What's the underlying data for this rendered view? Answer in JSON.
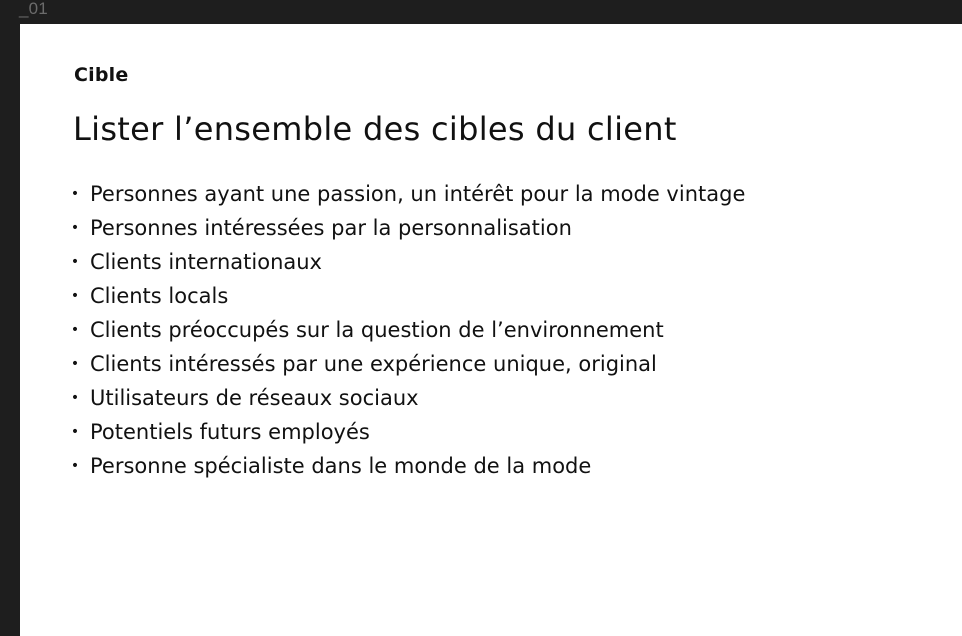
{
  "canvas": {
    "frame_label": "_01"
  },
  "slide": {
    "subtitle": "Cible",
    "title": "Lister l’ensemble des cibles du client",
    "items": [
      {
        "label": "Personnes ayant une passion, un intérêt pour la mode vintage"
      },
      {
        "label": "Personnes intéressées par la personnalisation"
      },
      {
        "label": "Clients internationaux"
      },
      {
        "label": "Clients locals"
      },
      {
        "label": "Clients préoccupés sur la question de l’environnement"
      },
      {
        "label": "Clients intéressés par une expérience unique, original"
      },
      {
        "label": "Utilisateurs de réseaux sociaux"
      },
      {
        "label": "Potentiels futurs employés"
      },
      {
        "label": "Personne spécialiste dans le monde de la mode"
      }
    ]
  }
}
